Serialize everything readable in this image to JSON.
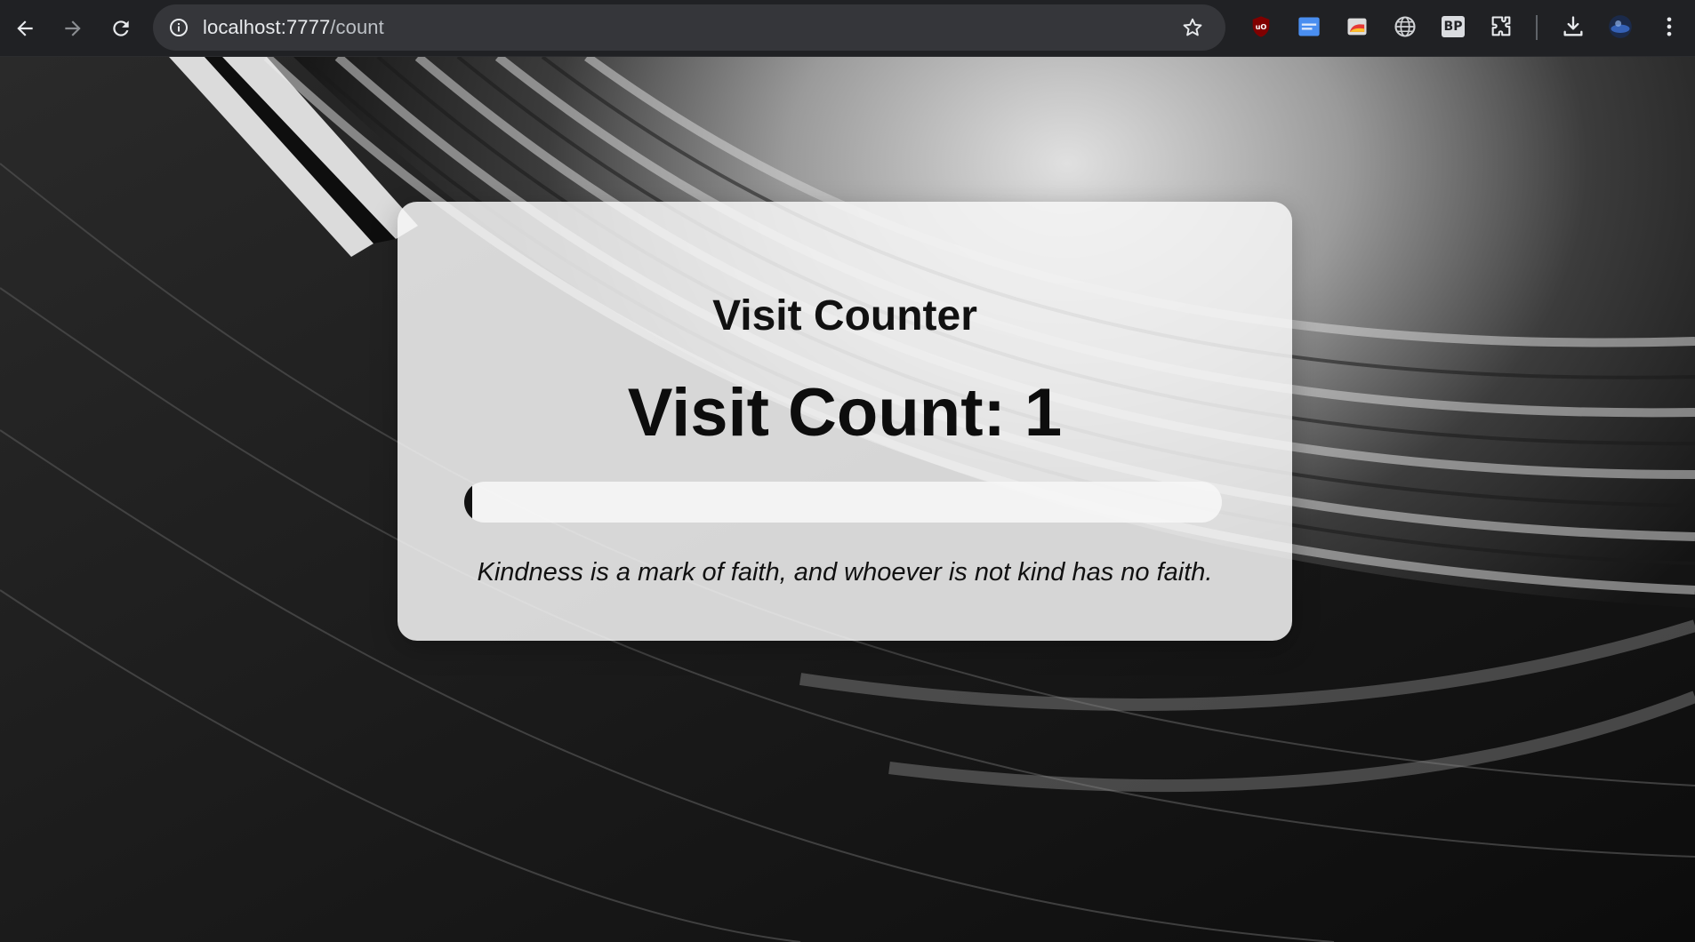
{
  "browser": {
    "url_host": "localhost:7777",
    "url_path": "/count"
  },
  "page": {
    "title": "Visit Counter",
    "visit_count_label": "Visit Count: 1",
    "progress_fraction": 0.01,
    "quote": "Kindness is a mark of faith, and whoever is not kind has no faith."
  },
  "extensions": {
    "bp_label": "BP"
  },
  "colors": {
    "card_background": "#f6f6f6",
    "progress_fill": "#111111",
    "chrome_background": "#202124"
  }
}
